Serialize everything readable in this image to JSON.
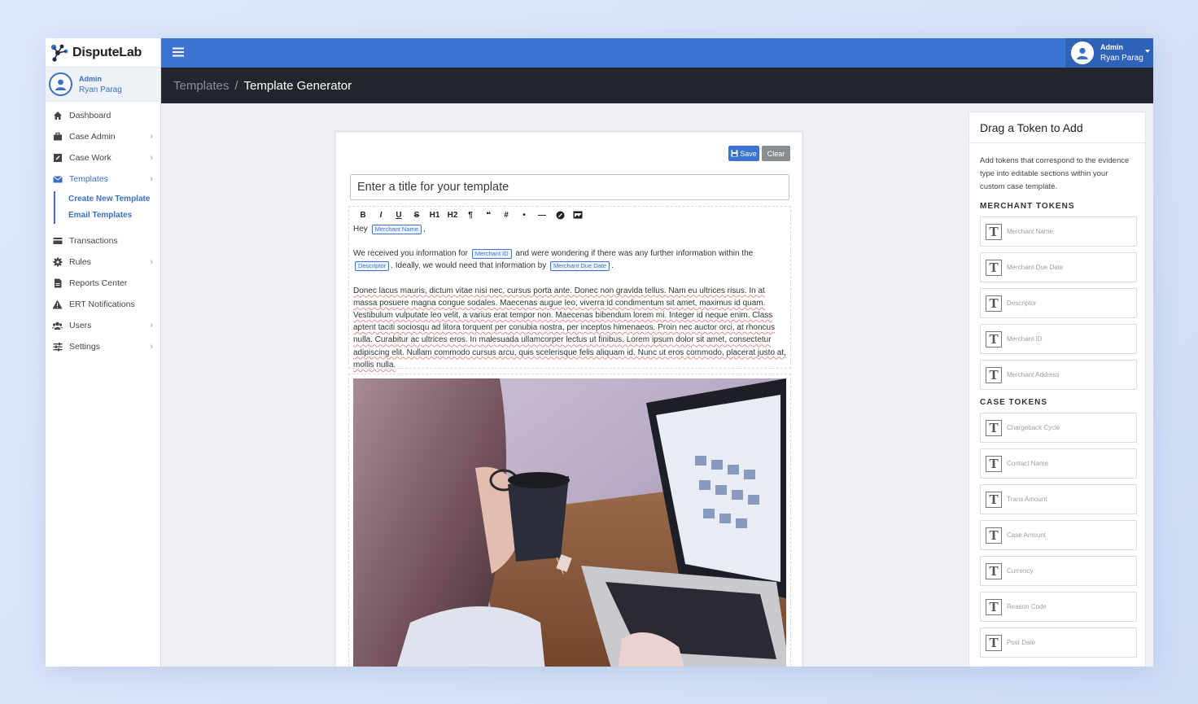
{
  "brand": {
    "name": "DisputeLab"
  },
  "sidebar": {
    "user": {
      "role": "Admin",
      "name": "Ryan Parag"
    },
    "items": [
      {
        "label": "Dashboard",
        "icon": "home-icon",
        "chevron": false
      },
      {
        "label": "Case Admin",
        "icon": "briefcase-icon",
        "chevron": true
      },
      {
        "label": "Case Work",
        "icon": "edit-icon",
        "chevron": true
      },
      {
        "label": "Templates",
        "icon": "envelope-icon",
        "chevron": true,
        "active": true
      },
      {
        "label": "Transactions",
        "icon": "credit-card-icon",
        "chevron": false
      },
      {
        "label": "Rules",
        "icon": "gear-icon",
        "chevron": true
      },
      {
        "label": "Reports Center",
        "icon": "file-icon",
        "chevron": false
      },
      {
        "label": "ERT Notifications",
        "icon": "warning-icon",
        "chevron": false
      },
      {
        "label": "Users",
        "icon": "users-icon",
        "chevron": true
      },
      {
        "label": "Settings",
        "icon": "sliders-icon",
        "chevron": true
      }
    ],
    "subitems": [
      "Create New Template",
      "Email Templates"
    ]
  },
  "topbar": {
    "user_role": "Admin",
    "user_name": "Ryan Parag"
  },
  "breadcrumb": {
    "parent": "Templates",
    "separator": "/",
    "current": "Template Generator"
  },
  "editor": {
    "save_label": "Save",
    "clear_label": "Clear",
    "title_placeholder": "Enter a title for your template",
    "toolbar": [
      "B",
      "I",
      "U",
      "S",
      "H1",
      "H2",
      "¶",
      "❝",
      "#",
      "•",
      "—",
      "link",
      "image"
    ],
    "greeting": "Hey",
    "greeting_end": ",",
    "p1_a": "We received you information for",
    "p1_b": "and were wondering if there was any further information within the",
    "p1_c": ". Ideally, we would need that information by",
    "p1_d": ".",
    "tokens_inline": {
      "merchant_name": "Merchant Name",
      "merchant_id": "Merchant ID",
      "descriptor": "Descriptor",
      "merchant_due_date": "Merchant Due Date"
    },
    "lorem": "Donec lacus mauris, dictum vitae nisi nec, cursus porta ante. Donec non gravida tellus. Nam eu ultrices risus.  In at massa posuere magna congue sodales. Maecenas augue leo, viverra id condimentum sit amet, maximus id quam. Vestibulum vulputate leo velit, a varius erat tempor non. Maecenas bibendum lorem mi. Integer id neque enim. Class aptent taciti sociosqu ad litora torquent per conubia nostra, per inceptos himenaeos. Proin nec auctor orci, at rhoncus nulla. Curabitur ac ultrices eros. In malesuada ullamcorper lectus ut finibus. Lorem ipsum dolor sit amet, consectetur adipiscing elit. Nullam commodo cursus arcu, quis scelerisque felis aliquam id. Nunc ut eros commodo, placerat justo at, mollis nulla."
  },
  "panel": {
    "title": "Drag a Token to Add",
    "description": "Add tokens that correspond to the evidence type into editable sections within your custom case template.",
    "merchant_heading": "MERCHANT TOKENS",
    "merchant_tokens": [
      "Merchant Name",
      "Merchant Due Date",
      "Descriptor",
      "Merchant ID",
      "Merchant Address"
    ],
    "case_heading": "CASE TOKENS",
    "case_tokens": [
      "Chargeback Cycle",
      "Contact Name",
      "Trans Amount",
      "Case Amount",
      "Currency",
      "Reason Code",
      "Post Date"
    ],
    "token_icon_letter": "T"
  },
  "colors": {
    "primary": "#3a73d0",
    "dark": "#23262d",
    "topbar_user": "#2e63b8"
  }
}
